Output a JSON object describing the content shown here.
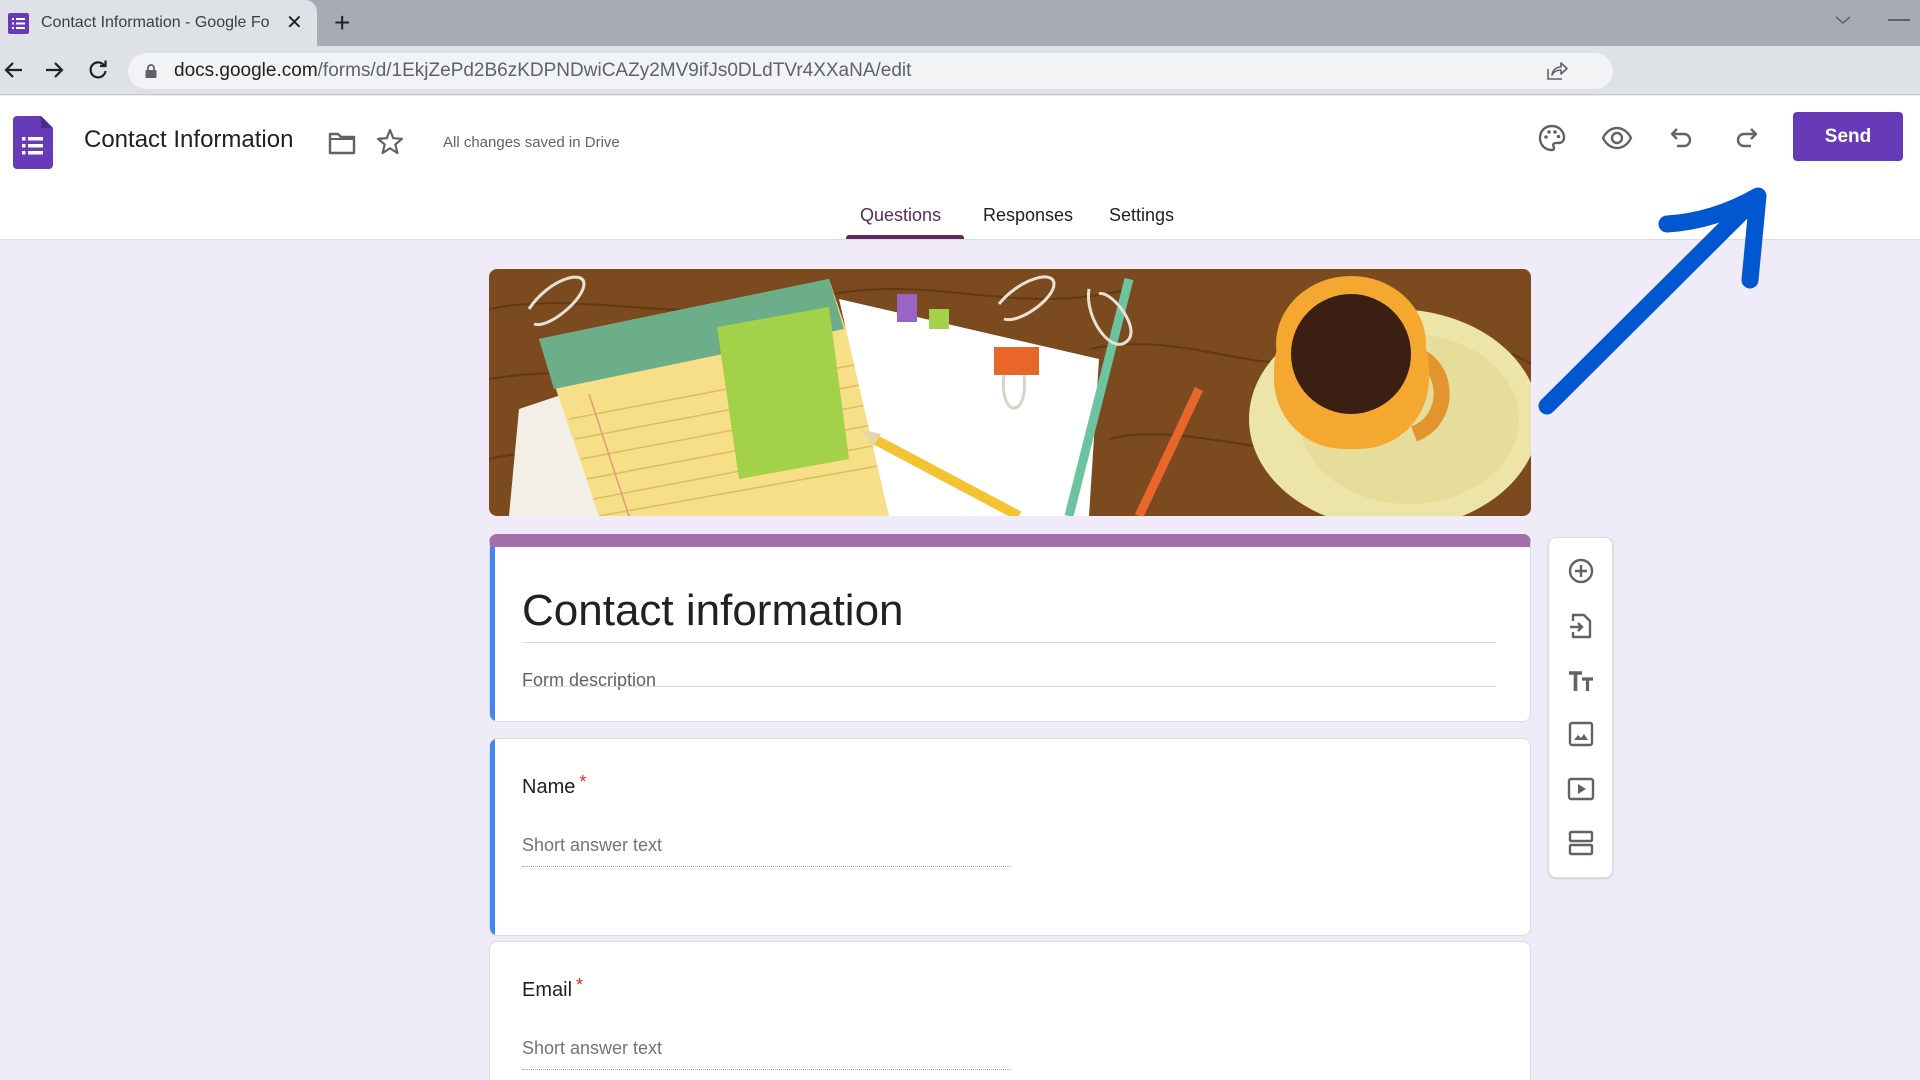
{
  "browser": {
    "tab_title": "Contact Information - Google Forms",
    "tab_title_visible": "Contact Information - Google Fo",
    "url_host": "docs.google.com",
    "url_path": "/forms/d/1EkjZePd2B6zKDPNDwiCAZy2MV9ifJs0DLdTVr4XXaNA/edit",
    "close_glyph": "✕",
    "new_tab_glyph": "+"
  },
  "header": {
    "doc_title": "Contact Information",
    "save_status": "All changes saved in Drive",
    "icons": [
      "palette-icon",
      "eye-icon",
      "undo-icon",
      "redo-icon"
    ],
    "send_label": "Send",
    "accent_color": "#673ab7"
  },
  "tabs": [
    {
      "label": "Questions",
      "active": true
    },
    {
      "label": "Responses",
      "active": false
    },
    {
      "label": "Settings",
      "active": false
    }
  ],
  "form": {
    "title": "Contact information",
    "description_placeholder": "Form description",
    "theme_color": "#a46eab",
    "questions": [
      {
        "label": "Name",
        "required": true,
        "required_mark": "*",
        "answer_placeholder": "Short answer text"
      },
      {
        "label": "Email",
        "required": true,
        "required_mark": "*",
        "answer_placeholder": "Short answer text"
      }
    ]
  },
  "tool_panel": {
    "items": [
      "add-question",
      "import-questions",
      "add-title-description",
      "add-image",
      "add-video",
      "add-section"
    ]
  },
  "annotation": {
    "type": "arrow",
    "color": "#0057d0",
    "points_to": "send-button"
  }
}
